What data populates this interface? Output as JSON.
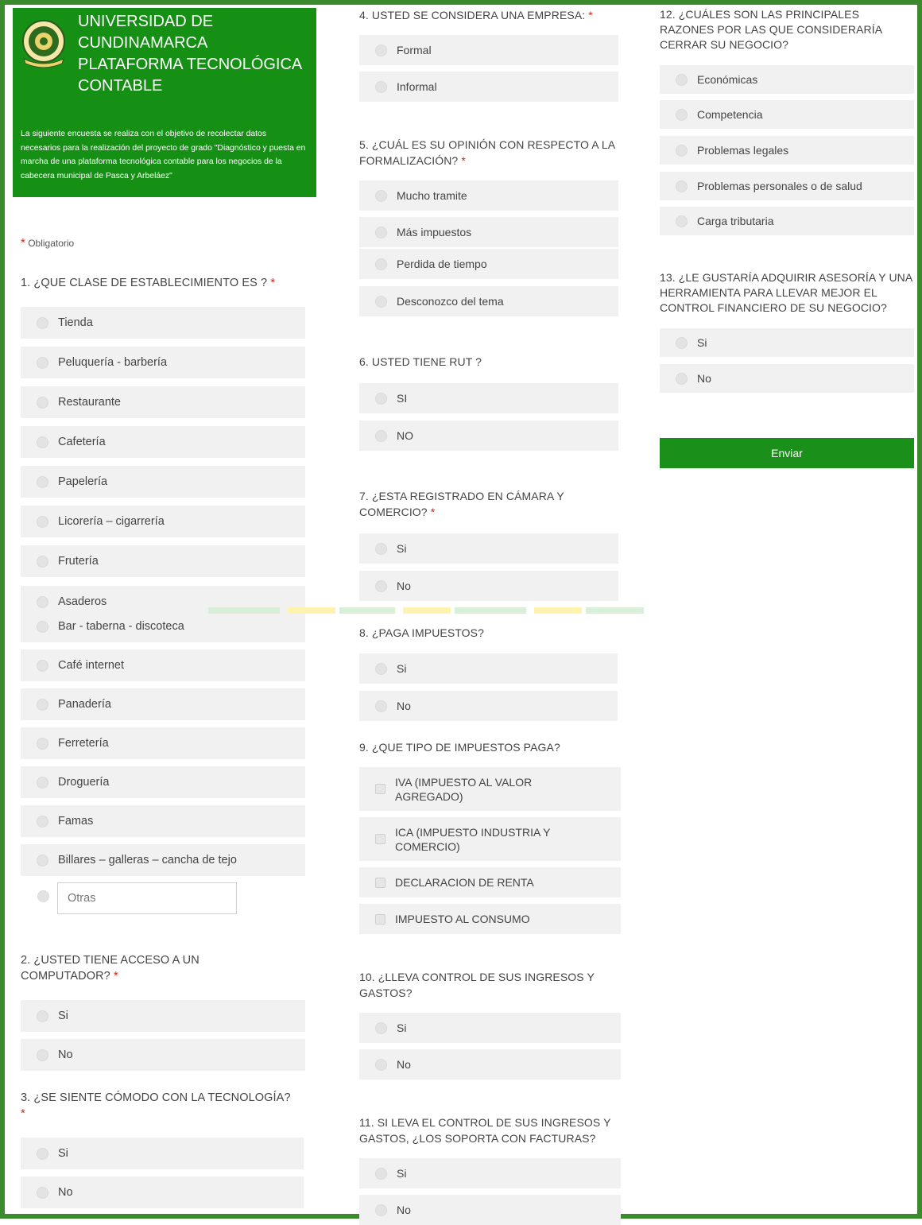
{
  "header": {
    "title": "UNIVERSIDAD DE\nCUNDINAMARCA\nPLATAFORMA TECNOLÓGICA\nCONTABLE",
    "description": "La siguiente encuesta se realiza con el objetivo de recolectar datos necesarios para la realización del proyecto de grado \"Diagnóstico y puesta en marcha de una plataforma tecnológica contable para los negocios de la cabecera municipal de Pasca y Arbeláez\"",
    "logo_icon": "university-seal-icon"
  },
  "required_note": {
    "star": "*",
    "text": "Obligatorio"
  },
  "q1": {
    "title": "1. ¿QUE CLASE DE ESTABLECIMIENTO ES ?",
    "star": "*",
    "options": [
      "Tienda",
      "Peluquería - barbería",
      "Restaurante",
      "Cafetería",
      "Papelería",
      "Licorería – cigarrería",
      "Frutería",
      "Asaderos",
      "Bar - taberna - discoteca",
      "Café internet",
      "Panadería",
      "Ferretería",
      "Droguería",
      "Famas",
      "Billares – galleras – cancha de tejo"
    ],
    "other_placeholder": "Otras"
  },
  "q2": {
    "title": "2. ¿USTED TIENE ACCESO A UN COMPUTADOR?",
    "star": "*",
    "options": [
      "Si",
      "No"
    ]
  },
  "q3": {
    "title": "3. ¿SE SIENTE CÓMODO CON LA TECNOLOGÍA?",
    "star": "*",
    "options": [
      "Si",
      "No"
    ]
  },
  "q4": {
    "title": "4. USTED SE CONSIDERA UNA EMPRESA:",
    "star": "*",
    "options": [
      "Formal",
      "Informal"
    ]
  },
  "q5": {
    "title": "5. ¿CUÁL ES SU OPINIÓN CON RESPECTO A LA FORMALIZACIÓN?",
    "star": "*",
    "options": [
      "Mucho tramite",
      "Más impuestos",
      "Perdida de tiempo",
      "Desconozco del tema"
    ]
  },
  "q6": {
    "title": "6. USTED TIENE RUT ?",
    "options": [
      "SI",
      "NO"
    ]
  },
  "q7": {
    "title": "7. ¿ESTA REGISTRADO EN CÁMARA Y COMERCIO?",
    "star": "*",
    "options": [
      "Si",
      "No"
    ]
  },
  "q8": {
    "title": "8. ¿PAGA IMPUESTOS?",
    "options": [
      "Si",
      "No"
    ]
  },
  "q9": {
    "title": "9. ¿QUE TIPO DE IMPUESTOS PAGA?",
    "options": [
      "IVA (IMPUESTO AL VALOR AGREGADO)",
      "ICA (IMPUESTO INDUSTRIA Y COMERCIO)",
      "DECLARACION DE RENTA",
      "IMPUESTO AL CONSUMO"
    ]
  },
  "q10": {
    "title": "10. ¿LLEVA CONTROL DE SUS INGRESOS Y GASTOS?",
    "options": [
      "Si",
      "No"
    ]
  },
  "q11": {
    "title": "11. SI LEVA EL CONTROL DE SUS INGRESOS Y GASTOS, ¿LOS SOPORTA CON FACTURAS?",
    "options": [
      "Si",
      "No"
    ]
  },
  "q12": {
    "title": "12. ¿CUÁLES SON LAS PRINCIPALES RAZONES POR LAS QUE CONSIDERARÍA CERRAR SU NEGOCIO?",
    "options": [
      "Económicas",
      "Competencia",
      "Problemas legales",
      "Problemas personales o de salud",
      "Carga tributaria"
    ]
  },
  "q13": {
    "title": "13. ¿LE GUSTARÍA ADQUIRIR ASESORÍA Y UNA HERRAMIENTA  PARA LLEVAR MEJOR EL CONTROL FINANCIERO DE SU NEGOCIO?",
    "options": [
      "Si",
      "No"
    ]
  },
  "submit_label": "Enviar",
  "colors": {
    "header_green": "#159015",
    "button_green": "#1a8f1a",
    "frame_green": "#3c8a2e",
    "required_red": "#d0241a",
    "option_bg": "#f1f1f1"
  }
}
